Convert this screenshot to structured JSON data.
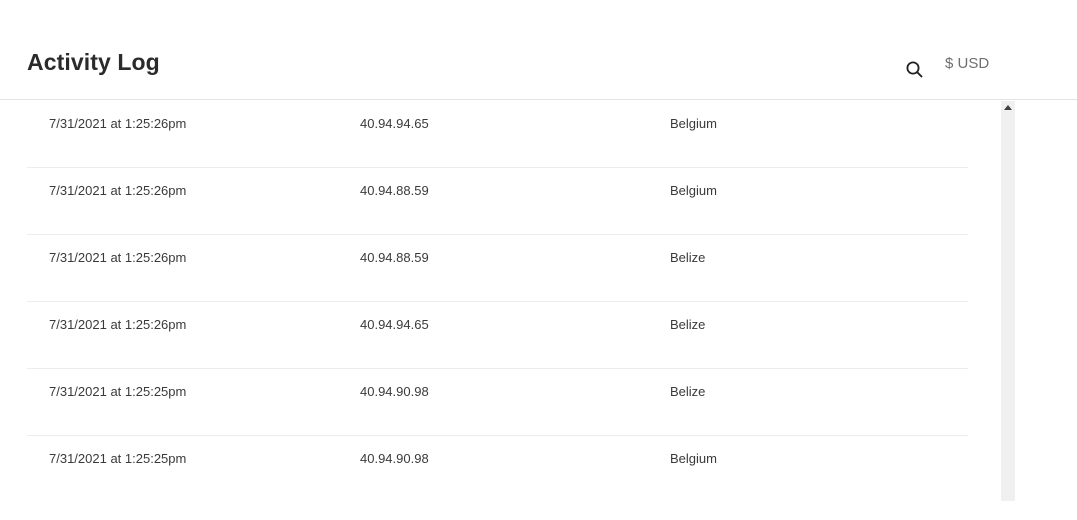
{
  "header": {
    "title": "Activity Log",
    "currency_label": "$ USD",
    "search_icon": "search-icon"
  },
  "activity": {
    "rows": [
      {
        "date": "7/31/2021 at 1:25:26pm",
        "ip": "40.94.94.65",
        "country": "Belgium"
      },
      {
        "date": "7/31/2021 at 1:25:26pm",
        "ip": "40.94.88.59",
        "country": "Belgium"
      },
      {
        "date": "7/31/2021 at 1:25:26pm",
        "ip": "40.94.88.59",
        "country": "Belize"
      },
      {
        "date": "7/31/2021 at 1:25:26pm",
        "ip": "40.94.94.65",
        "country": "Belize"
      },
      {
        "date": "7/31/2021 at 1:25:25pm",
        "ip": "40.94.90.98",
        "country": "Belize"
      },
      {
        "date": "7/31/2021 at 1:25:25pm",
        "ip": "40.94.90.98",
        "country": "Belgium"
      }
    ]
  },
  "colors": {
    "title": "#2b2b2b",
    "muted": "#707070",
    "divider": "#ededed",
    "scrollbar_track": "#f0f0f0"
  }
}
